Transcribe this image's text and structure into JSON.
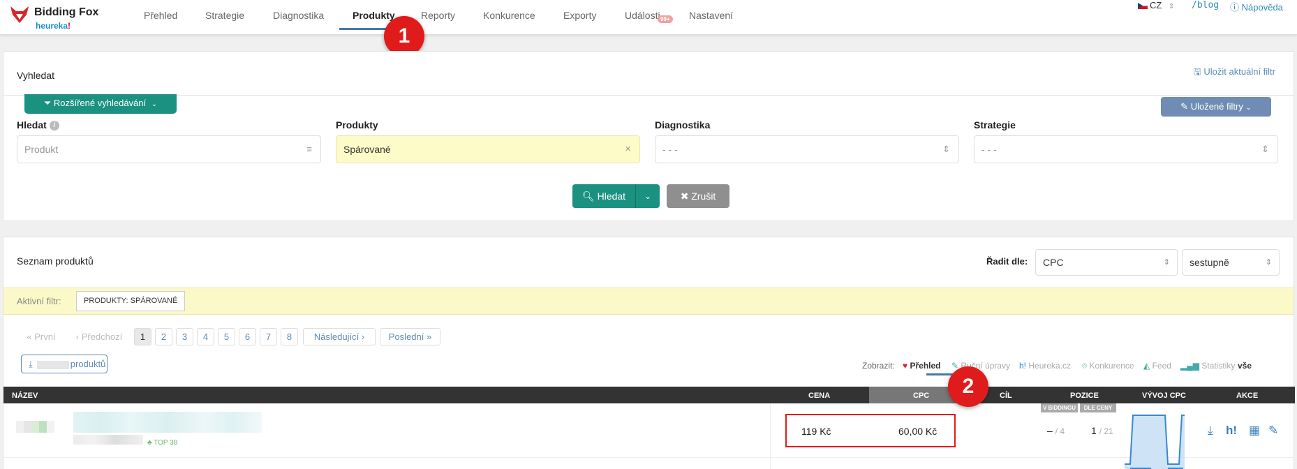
{
  "nav": {
    "brand": "Bidding Fox",
    "sub_brand": "heureka",
    "sub_brand_mark": "!",
    "items": [
      "Přehled",
      "Strategie",
      "Diagnostika",
      "Produkty",
      "Reporty",
      "Konkurence",
      "Exporty",
      "Události",
      "Nastavení"
    ],
    "active": "Produkty",
    "events_badge": "99+",
    "lang": "CZ",
    "blog": "/blog",
    "help": "Nápověda"
  },
  "markers": [
    "1",
    "2"
  ],
  "search": {
    "title": "Vyhledat",
    "save_filter": "Uložit aktuální filtr",
    "extended": "Rozšířené vyhledávání",
    "saved_filters": "Uložené filtry",
    "fields": [
      {
        "label": "Hledat",
        "placeholder": "Produkt",
        "value": ""
      },
      {
        "label": "Produkty",
        "placeholder": "",
        "value": "Spárované"
      },
      {
        "label": "Diagnostika",
        "placeholder": "- - -",
        "value": ""
      },
      {
        "label": "Strategie",
        "placeholder": "- - -",
        "value": ""
      }
    ],
    "search_btn": "Hledat",
    "cancel_btn": "Zrušit"
  },
  "products": {
    "title": "Seznam produktů",
    "sort_label": "Řadit dle:",
    "sort_field": "CPC",
    "sort_dir": "sestupně",
    "active_filter_label": "Aktivní filtr:",
    "active_filter_tag": "PRODUKTY: SPÁROVANÉ",
    "pagination": {
      "first": "První",
      "prev": "Předchozí",
      "pages": [
        "1",
        "2",
        "3",
        "4",
        "5",
        "6",
        "7",
        "8"
      ],
      "current": "1",
      "next": "Následující",
      "last": "Poslední"
    },
    "export_suffix": "produktů",
    "show_label": "Zobrazit:",
    "show_tabs": [
      "Přehled",
      "Ruční úpravy",
      "Heureka.cz",
      "Konkurence",
      "Feed",
      "Statistiky",
      "vše"
    ],
    "show_active": "Přehled",
    "columns": [
      "NÁZEV",
      "CENA",
      "CPC",
      "CÍL",
      "POZICE",
      "VÝVOJ CPC",
      "AKCE"
    ],
    "position_sub": [
      "V BIDDINGU",
      "DLE CENY"
    ],
    "rows": [
      {
        "tag": "TOP 38",
        "price": "119 Kč",
        "cpc": "60,00 Kč",
        "pos_bidding": "–",
        "pos_bidding_total": "4",
        "pos_price": "1",
        "pos_price_total": "21"
      }
    ]
  },
  "colors": {
    "primary": "#1b9181",
    "nav_accent": "#4a77a8",
    "link": "#5b8ab3",
    "highlight": "#e01b1b",
    "filter_bg": "#fbf9c7"
  }
}
